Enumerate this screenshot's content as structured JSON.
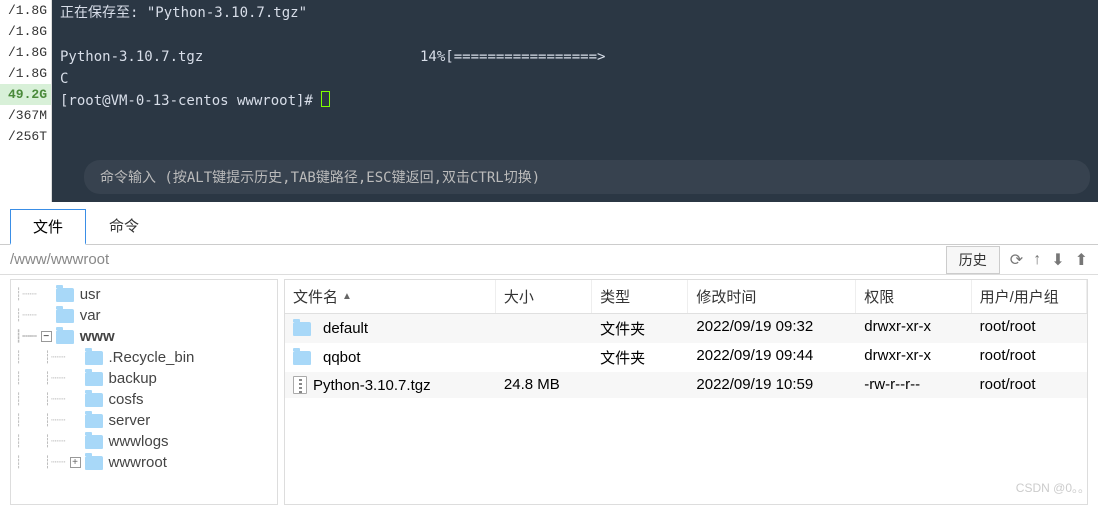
{
  "disk_rows": [
    "/1.8G",
    "/1.8G",
    "/1.8G",
    "/1.8G",
    "49.2G",
    "/367M",
    "/256T"
  ],
  "disk_highlight_index": 4,
  "terminal": {
    "saving_prefix": "正在保存至: ",
    "saving_file": "\"Python-3.10.7.tgz\"",
    "download_file": "Python-3.10.7.tgz",
    "progress_pct": "14%",
    "progress_bar": "[=================>",
    "c_line": "C",
    "prompt": "[root@VM-0-13-centos wwwroot]#",
    "input_hint": "命令输入 (按ALT键提示历史,TAB键路径,ESC键返回,双击CTRL切换)"
  },
  "tabs": {
    "files": "文件",
    "command": "命令"
  },
  "path": "/www/wwwroot",
  "history_btn": "历史",
  "tree": {
    "items": [
      {
        "label": "usr",
        "depth": 1,
        "exp": null
      },
      {
        "label": "var",
        "depth": 1,
        "exp": null
      },
      {
        "label": "www",
        "depth": 1,
        "exp": "minus",
        "current": true
      },
      {
        "label": ".Recycle_bin",
        "depth": 2,
        "exp": null
      },
      {
        "label": "backup",
        "depth": 2,
        "exp": null
      },
      {
        "label": "cosfs",
        "depth": 2,
        "exp": null
      },
      {
        "label": "server",
        "depth": 2,
        "exp": null
      },
      {
        "label": "wwwlogs",
        "depth": 2,
        "exp": null
      },
      {
        "label": "wwwroot",
        "depth": 2,
        "exp": "plus"
      }
    ]
  },
  "file_header": {
    "name": "文件名",
    "size": "大小",
    "type": "类型",
    "mtime": "修改时间",
    "perm": "权限",
    "owner": "用户/用户组"
  },
  "files": [
    {
      "name": "default",
      "icon": "folder",
      "size": "",
      "type": "文件夹",
      "mtime": "2022/09/19 09:32",
      "perm": "drwxr-xr-x",
      "owner": "root/root"
    },
    {
      "name": "qqbot",
      "icon": "folder",
      "size": "",
      "type": "文件夹",
      "mtime": "2022/09/19 09:44",
      "perm": "drwxr-xr-x",
      "owner": "root/root"
    },
    {
      "name": "Python-3.10.7.tgz",
      "icon": "archive",
      "size": "24.8 MB",
      "type": "",
      "mtime": "2022/09/19 10:59",
      "perm": "-rw-r--r--",
      "owner": "root/root"
    }
  ],
  "watermark": "CSDN @0。。"
}
